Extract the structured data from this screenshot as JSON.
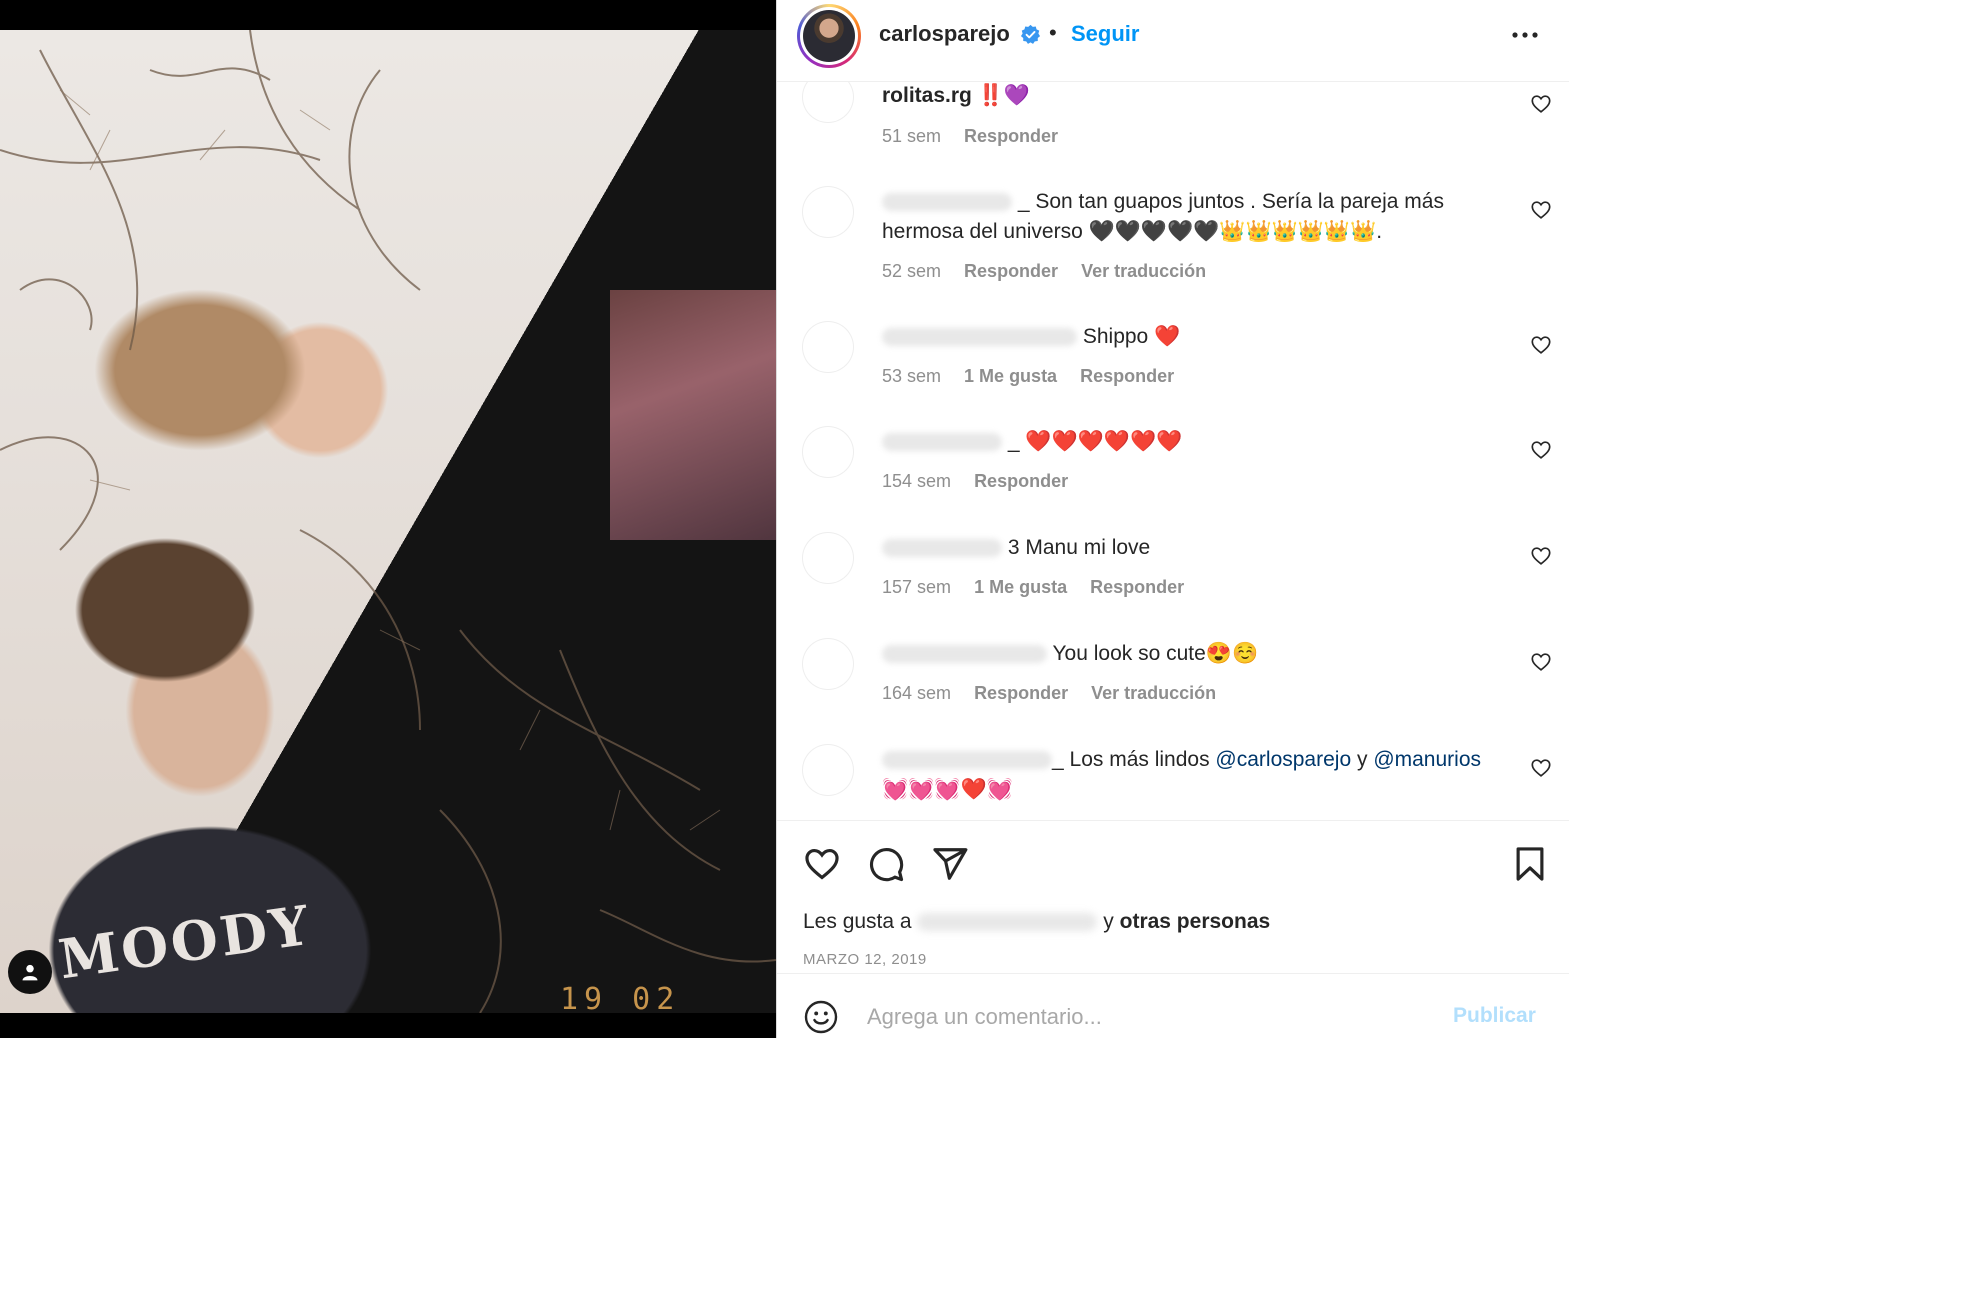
{
  "photo": {
    "shirt_text": "MOODY",
    "date_stamp": "19 02 '19"
  },
  "header": {
    "username": "carlosparejo",
    "separator": "•",
    "follow_label": "Seguir"
  },
  "comments": [
    {
      "username": "rolitas.rg",
      "text": "‼️💜",
      "time": "51 sem",
      "likes": "",
      "reply": "Responder",
      "translate": ""
    },
    {
      "username": "",
      "text": "_ Son tan guapos juntos . Sería la pareja más hermosa del universo 🖤🖤🖤🖤🖤👑👑👑👑👑👑.",
      "time": "52 sem",
      "likes": "",
      "reply": "Responder",
      "translate": "Ver traducción"
    },
    {
      "username": "",
      "text": "Shippo ❤️",
      "time": "53 sem",
      "likes": "1 Me gusta",
      "reply": "Responder",
      "translate": ""
    },
    {
      "username": "",
      "text": "_ ❤️❤️❤️❤️❤️❤️",
      "time": "154 sem",
      "likes": "",
      "reply": "Responder",
      "translate": ""
    },
    {
      "username": "",
      "text": "3 Manu mi love",
      "time": "157 sem",
      "likes": "1 Me gusta",
      "reply": "Responder",
      "translate": ""
    },
    {
      "username": "",
      "text": "You look so cute😍☺️",
      "time": "164 sem",
      "likes": "",
      "reply": "Responder",
      "translate": "Ver traducción"
    },
    {
      "username": "",
      "text_before": "_ Los más lindos ",
      "mention1": "@carlosparejo",
      "text_mid": " y ",
      "mention2": "@manurios",
      "text_after": " 💓💓💓❤️💓"
    }
  ],
  "likes": {
    "prefix": "Les gusta a",
    "mid": "y",
    "suffix": "otras personas"
  },
  "date": "MARZO 12, 2019",
  "add_comment": {
    "placeholder": "Agrega un comentario...",
    "publish_label": "Publicar"
  },
  "colors": {
    "accent": "#0095f6",
    "publish_disabled": "#b2dffc",
    "text": "#262626",
    "muted": "#8e8e8e",
    "mention": "#00376b"
  },
  "icons": [
    "user-tag-icon",
    "verified-badge-icon",
    "more-options-icon",
    "heart-icon",
    "comment-icon",
    "share-icon",
    "bookmark-icon",
    "emoji-icon"
  ]
}
